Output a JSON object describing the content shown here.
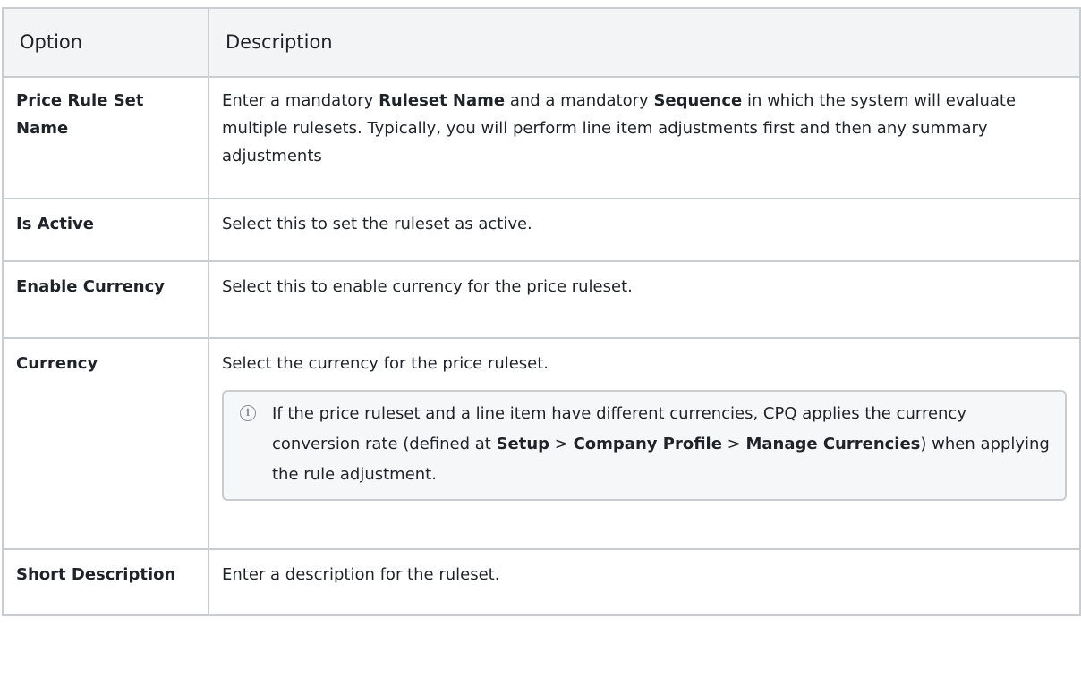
{
  "header": {
    "option": "Option",
    "description": "Description"
  },
  "rows": [
    {
      "option": "Price Rule Set Name",
      "desc": {
        "t1": "Enter a mandatory ",
        "b1": "Ruleset Name",
        "t2": " and a mandatory ",
        "b2": "Sequence",
        "t3": " in which the system will evaluate multiple rulesets. Typically, you will perform line item adjustments first and then any summary adjustments"
      }
    },
    {
      "option": "Is Active",
      "desc": "Select this to set the ruleset as active."
    },
    {
      "option": "Enable Currency",
      "desc": "Select this to enable currency for the price ruleset."
    },
    {
      "option": "Currency",
      "desc": "Select the currency for the price ruleset.",
      "note": {
        "icon": "info-icon",
        "t1": "If the price ruleset and a line item have different currencies, CPQ applies the currency conversion rate (defined at ",
        "b1": "Setup",
        "t2": " > ",
        "b2": "Company Profile",
        "t3": " > ",
        "b3": "Manage Currencies",
        "t4": ") when applying the rule adjustment."
      }
    },
    {
      "option": "Short Description",
      "desc": "Enter a description for the ruleset."
    }
  ]
}
